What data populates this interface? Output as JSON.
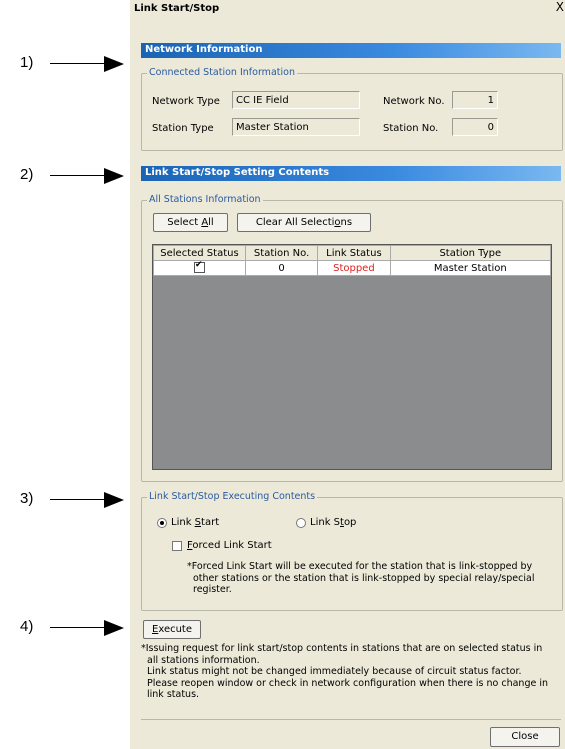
{
  "callouts": [
    "1)",
    "2)",
    "3)",
    "4)"
  ],
  "window": {
    "title": "Link Start/Stop",
    "close_glyph": "X"
  },
  "network_info": {
    "header": "Network Information",
    "group_label": "Connected Station Information",
    "network_type_label": "Network Type",
    "network_type_value": "CC IE Field",
    "network_no_label": "Network No.",
    "network_no_value": "1",
    "station_type_label": "Station Type",
    "station_type_value": "Master Station",
    "station_no_label": "Station No.",
    "station_no_value": "0"
  },
  "setting": {
    "header": "Link Start/Stop Setting Contents",
    "group_label": "All Stations Information",
    "select_all_pre": "Select ",
    "select_all_key": "A",
    "select_all_post": "ll",
    "clear_pre": "Clear All Selecti",
    "clear_key": "o",
    "clear_post": "ns",
    "columns": [
      "Selected Status",
      "Station No.",
      "Link Status",
      "Station Type"
    ],
    "row": {
      "station_no": "0",
      "link_status": "Stopped",
      "station_type": "Master Station"
    }
  },
  "executing": {
    "group_label": "Link Start/Stop Executing Contents",
    "link_start_pre": "Link ",
    "link_start_key": "S",
    "link_start_post": "tart",
    "link_stop_pre": "Link S",
    "link_stop_key": "t",
    "link_stop_post": "op",
    "forced_key": "F",
    "forced_post": "orced Link Start",
    "forced_note_1": "*Forced Link Start will be executed for the station that is link-stopped by",
    "forced_note_2": "other stations or the station that is link-stopped by special relay/special",
    "forced_note_3": "register."
  },
  "execute": {
    "key": "E",
    "post": "xecute",
    "note_1": "*Issuing request for link start/stop contents in stations that are on selected status in",
    "note_2": "all stations information.",
    "note_3": "Link status might not be changed immediately because of circuit status factor.",
    "note_4": "Please reopen window or check in network configuration when there is no change in",
    "note_5": "link status."
  },
  "close_label": "Close"
}
